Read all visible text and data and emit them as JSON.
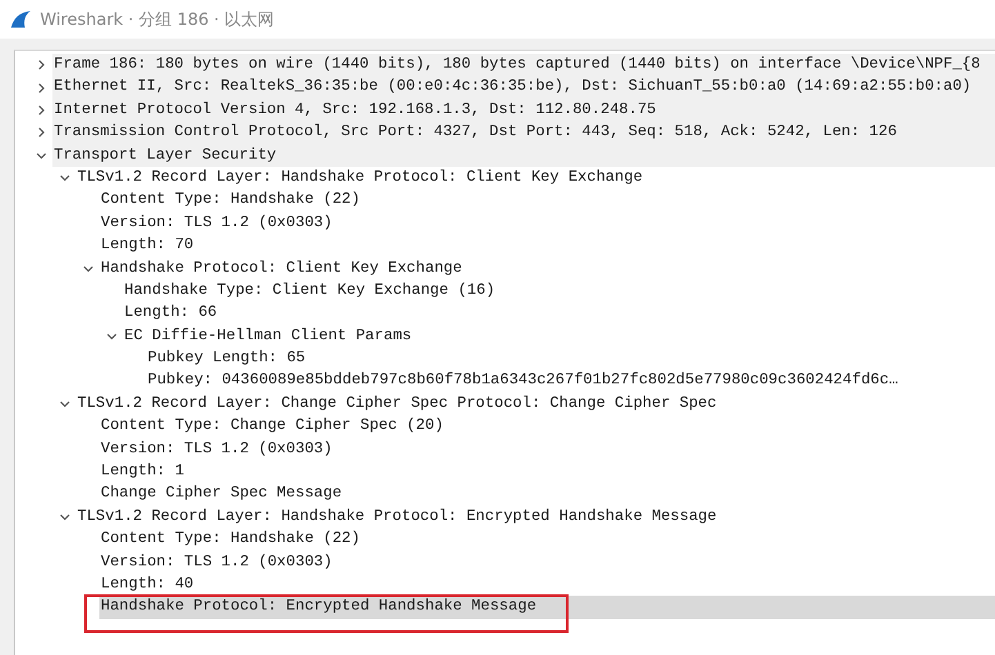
{
  "window": {
    "title": "Wireshark · 分组 186 · 以太网"
  },
  "tree": [
    {
      "text": "Frame 186: 180 bytes on wire (1440 bits), 180 bytes captured (1440 bits) on interface \\Device\\NPF_{8",
      "shaded": true,
      "expanded": false,
      "selected": false
    },
    {
      "text": "Ethernet II, Src: RealtekS_36:35:be (00:e0:4c:36:35:be), Dst: SichuanT_55:b0:a0 (14:69:a2:55:b0:a0)",
      "shaded": true,
      "expanded": false,
      "selected": false
    },
    {
      "text": "Internet Protocol Version 4, Src: 192.168.1.3, Dst: 112.80.248.75",
      "shaded": true,
      "expanded": false,
      "selected": false
    },
    {
      "text": "Transmission Control Protocol, Src Port: 4327, Dst Port: 443, Seq: 518, Ack: 5242, Len: 126",
      "shaded": true,
      "expanded": false,
      "selected": false
    },
    {
      "text": "Transport Layer Security",
      "shaded": true,
      "expanded": true,
      "selected": false,
      "children": [
        {
          "text": "TLSv1.2 Record Layer: Handshake Protocol: Client Key Exchange",
          "shaded": false,
          "expanded": true,
          "selected": false,
          "children": [
            {
              "text": "Content Type: Handshake (22)",
              "shaded": false,
              "selected": false
            },
            {
              "text": "Version: TLS 1.2 (0x0303)",
              "shaded": false,
              "selected": false
            },
            {
              "text": "Length: 70",
              "shaded": false,
              "selected": false
            },
            {
              "text": "Handshake Protocol: Client Key Exchange",
              "shaded": false,
              "expanded": true,
              "selected": false,
              "children": [
                {
                  "text": "Handshake Type: Client Key Exchange (16)",
                  "shaded": false,
                  "selected": false
                },
                {
                  "text": "Length: 66",
                  "shaded": false,
                  "selected": false
                },
                {
                  "text": "EC Diffie-Hellman Client Params",
                  "shaded": false,
                  "expanded": true,
                  "selected": false,
                  "children": [
                    {
                      "text": "Pubkey Length: 65",
                      "shaded": false,
                      "selected": false
                    },
                    {
                      "text": "Pubkey: 04360089e85bddeb797c8b60f78b1a6343c267f01b27fc802d5e77980c09c3602424fd6c…",
                      "shaded": false,
                      "selected": false
                    }
                  ]
                }
              ]
            }
          ]
        },
        {
          "text": "TLSv1.2 Record Layer: Change Cipher Spec Protocol: Change Cipher Spec",
          "shaded": false,
          "expanded": true,
          "selected": false,
          "children": [
            {
              "text": "Content Type: Change Cipher Spec (20)",
              "shaded": false,
              "selected": false
            },
            {
              "text": "Version: TLS 1.2 (0x0303)",
              "shaded": false,
              "selected": false
            },
            {
              "text": "Length: 1",
              "shaded": false,
              "selected": false
            },
            {
              "text": "Change Cipher Spec Message",
              "shaded": false,
              "selected": false
            }
          ]
        },
        {
          "text": "TLSv1.2 Record Layer: Handshake Protocol: Encrypted Handshake Message",
          "shaded": false,
          "expanded": true,
          "selected": false,
          "children": [
            {
              "text": "Content Type: Handshake (22)",
              "shaded": false,
              "selected": false
            },
            {
              "text": "Version: TLS 1.2 (0x0303)",
              "shaded": false,
              "selected": false
            },
            {
              "text": "Length: 40",
              "shaded": false,
              "selected": false
            },
            {
              "text": "Handshake Protocol: Encrypted Handshake Message",
              "shaded": false,
              "selected": true,
              "boxed": true
            }
          ]
        }
      ]
    }
  ]
}
